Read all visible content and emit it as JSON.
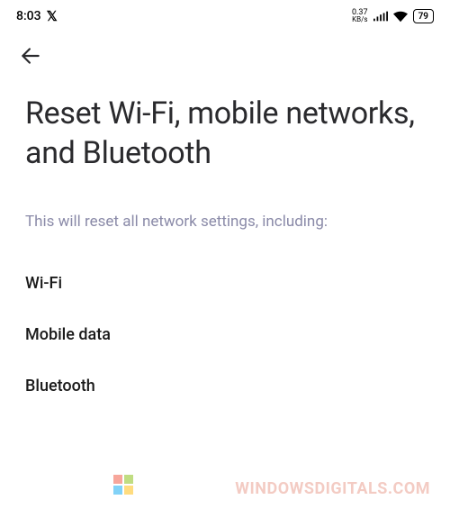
{
  "status_bar": {
    "time": "8:03",
    "app_indicator": "𝕏",
    "data_rate_value": "0.37",
    "data_rate_unit": "KB/s",
    "battery_percent": "79"
  },
  "page": {
    "title": "Reset Wi-Fi, mobile networks, and Bluetooth",
    "description": "This will reset all network settings, including:"
  },
  "items": [
    "Wi-Fi",
    "Mobile data",
    "Bluetooth"
  ],
  "watermark": "WindowsDigitals.com"
}
